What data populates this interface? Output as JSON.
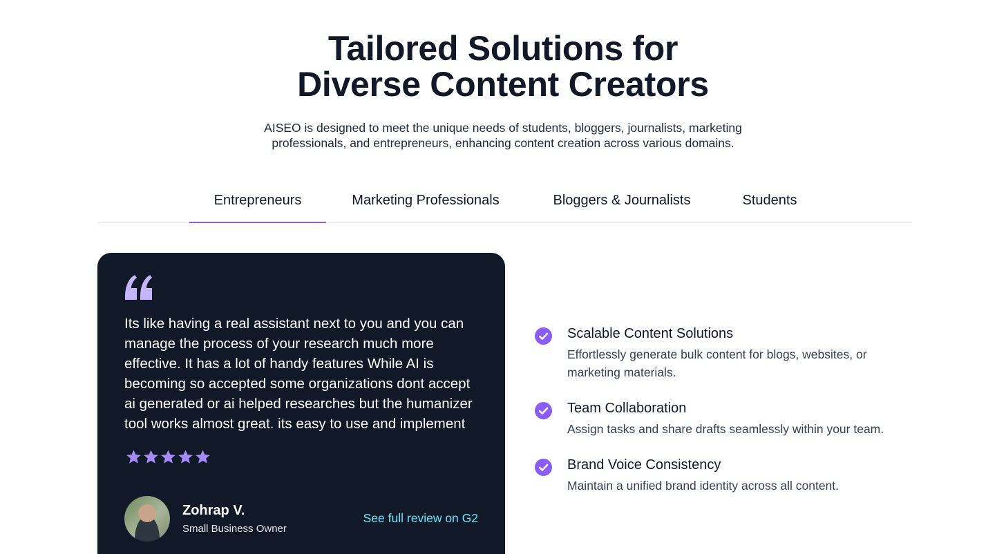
{
  "header": {
    "title_line1": "Tailored Solutions for",
    "title_line2": "Diverse Content Creators",
    "subtitle": "AISEO is designed to meet the unique needs of students, bloggers, journalists, marketing professionals, and entrepreneurs, enhancing content creation across various domains."
  },
  "tabs": [
    {
      "label": "Entrepreneurs",
      "active": true
    },
    {
      "label": "Marketing Professionals",
      "active": false
    },
    {
      "label": "Bloggers & Journalists",
      "active": false
    },
    {
      "label": "Students",
      "active": false
    }
  ],
  "testimonial": {
    "quote": "Its like having a real assistant next to you and you can manage the process of your research much more effective. It has a lot of handy features While AI is becoming so accepted some organizations dont accept ai generated or ai helped researches but the humanizer tool works almost great. its easy to use and implement",
    "rating": 5,
    "reviewer_name": "Zohrap V.",
    "reviewer_role": "Small Business Owner",
    "link_label": "See full review on G2",
    "icons": [
      "quote-icon",
      "star-icon"
    ]
  },
  "features": [
    {
      "title": "Scalable Content Solutions",
      "description": "Effortlessly generate bulk content for blogs, websites, or marketing materials.",
      "icon": "check-circle-icon"
    },
    {
      "title": "Team Collaboration",
      "description": "Assign tasks and share drafts seamlessly within your team.",
      "icon": "check-circle-icon"
    },
    {
      "title": "Brand Voice Consistency",
      "description": "Maintain a unified brand identity across all content.",
      "icon": "check-circle-icon"
    }
  ],
  "colors": {
    "accent": "#8b5cf6",
    "card_background": "#111827",
    "link": "#67e8f9",
    "star": "#a78bfa"
  }
}
